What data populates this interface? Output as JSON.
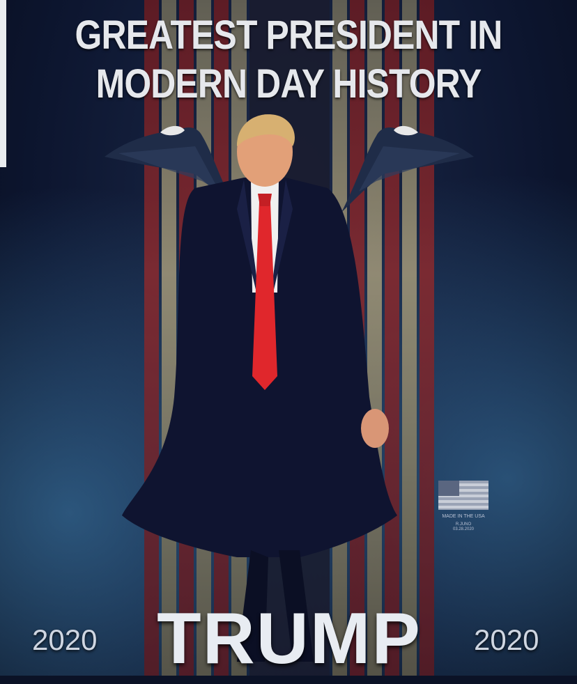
{
  "headline": {
    "line1": "GREATEST PRESIDENT IN",
    "line2": "MODERN DAY HISTORY"
  },
  "badge": {
    "made_in": "MADE IN THE USA",
    "artist": "R.JUNO",
    "date": "03.28.2020"
  },
  "footer": {
    "year_left": "2020",
    "name": "TRUMP",
    "year_right": "2020"
  },
  "colors": {
    "background": "#0d1630",
    "text": "#e6e8ec",
    "tie": "#e0272c",
    "flag_red": "#8b2a2e"
  },
  "icons": {
    "left_eagle": "eagle-icon",
    "right_eagle": "eagle-icon",
    "flag": "us-flag-icon"
  }
}
